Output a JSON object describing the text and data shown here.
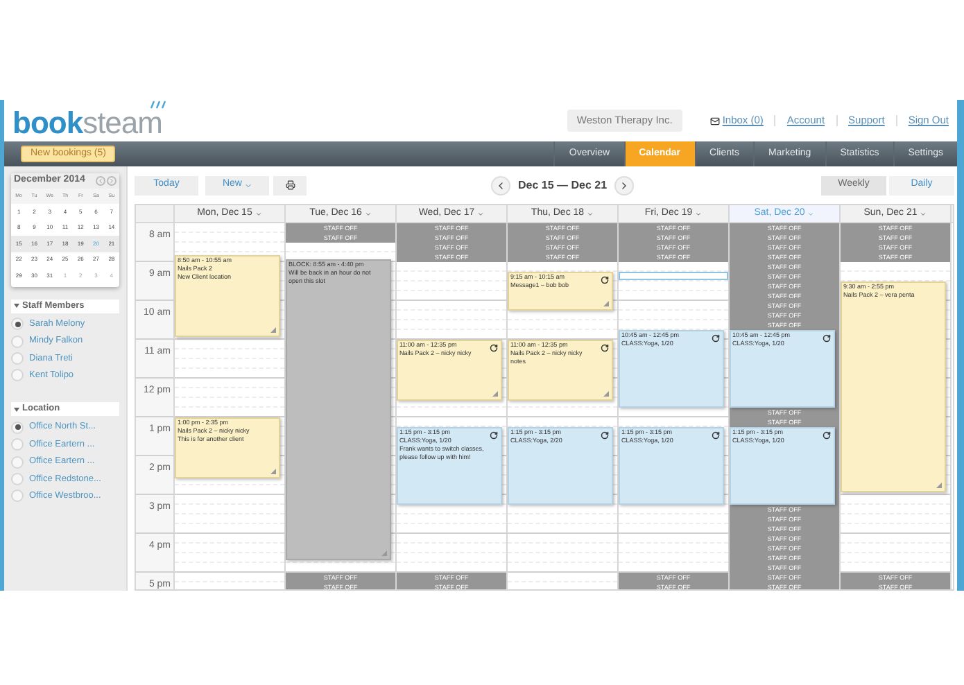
{
  "logo": {
    "bold": "book",
    "light": "steam"
  },
  "header": {
    "company": "Weston Therapy Inc.",
    "links": [
      {
        "label": "Inbox (0)",
        "kind": "inbox"
      },
      {
        "label": "Account",
        "kind": "link"
      },
      {
        "label": "Support",
        "kind": "link"
      },
      {
        "label": "Sign Out",
        "kind": "link"
      }
    ]
  },
  "new_bookings": "New bookings (5)",
  "nav": [
    {
      "label": "Overview",
      "selected": false
    },
    {
      "label": "Calendar",
      "selected": true
    },
    {
      "label": "Clients",
      "selected": false
    },
    {
      "label": "Marketing",
      "selected": false
    },
    {
      "label": "Statistics",
      "selected": false
    },
    {
      "label": "Settings",
      "selected": false
    }
  ],
  "mini_calendar": {
    "title": "December 2014",
    "weekdays": [
      "Mo",
      "Tu",
      "We",
      "Th",
      "Fr",
      "Sa",
      "Su"
    ],
    "weeks": [
      {
        "selected": false,
        "days": [
          {
            "label": "1",
            "muted": false,
            "today": false
          },
          {
            "label": "2",
            "muted": false,
            "today": false
          },
          {
            "label": "3",
            "muted": false,
            "today": false
          },
          {
            "label": "4",
            "muted": false,
            "today": false
          },
          {
            "label": "5",
            "muted": false,
            "today": false
          },
          {
            "label": "6",
            "muted": false,
            "today": false
          },
          {
            "label": "7",
            "muted": false,
            "today": false
          }
        ]
      },
      {
        "selected": false,
        "days": [
          {
            "label": "8",
            "muted": false,
            "today": false
          },
          {
            "label": "9",
            "muted": false,
            "today": false
          },
          {
            "label": "10",
            "muted": false,
            "today": false
          },
          {
            "label": "11",
            "muted": false,
            "today": false
          },
          {
            "label": "12",
            "muted": false,
            "today": false
          },
          {
            "label": "13",
            "muted": false,
            "today": false
          },
          {
            "label": "14",
            "muted": false,
            "today": false
          }
        ]
      },
      {
        "selected": true,
        "days": [
          {
            "label": "15",
            "muted": false,
            "today": false
          },
          {
            "label": "16",
            "muted": false,
            "today": false
          },
          {
            "label": "17",
            "muted": false,
            "today": false
          },
          {
            "label": "18",
            "muted": false,
            "today": false
          },
          {
            "label": "19",
            "muted": false,
            "today": false
          },
          {
            "label": "20",
            "muted": false,
            "today": true
          },
          {
            "label": "21",
            "muted": false,
            "today": false
          }
        ]
      },
      {
        "selected": false,
        "days": [
          {
            "label": "22",
            "muted": false,
            "today": false
          },
          {
            "label": "23",
            "muted": false,
            "today": false
          },
          {
            "label": "24",
            "muted": false,
            "today": false
          },
          {
            "label": "25",
            "muted": false,
            "today": false
          },
          {
            "label": "26",
            "muted": false,
            "today": false
          },
          {
            "label": "27",
            "muted": false,
            "today": false
          },
          {
            "label": "28",
            "muted": false,
            "today": false
          }
        ]
      },
      {
        "selected": false,
        "days": [
          {
            "label": "29",
            "muted": false,
            "today": false
          },
          {
            "label": "30",
            "muted": false,
            "today": false
          },
          {
            "label": "31",
            "muted": false,
            "today": false
          },
          {
            "label": "1",
            "muted": true,
            "today": false
          },
          {
            "label": "2",
            "muted": true,
            "today": false
          },
          {
            "label": "3",
            "muted": true,
            "today": false
          },
          {
            "label": "4",
            "muted": true,
            "today": false
          }
        ]
      }
    ]
  },
  "sections": [
    {
      "title": "Staff Members",
      "items": [
        {
          "label": "Sarah Melony",
          "selected": true
        },
        {
          "label": "Mindy Falkon",
          "selected": false
        },
        {
          "label": "Diana Treti",
          "selected": false
        },
        {
          "label": "Kent Tolipo",
          "selected": false
        }
      ]
    },
    {
      "title": "Location",
      "items": [
        {
          "label": "Office North St...",
          "selected": true
        },
        {
          "label": "Office Eartern ...",
          "selected": false
        },
        {
          "label": "Office Eartern ...",
          "selected": false
        },
        {
          "label": "Office Redstone...",
          "selected": false
        },
        {
          "label": "Office Westbroo...",
          "selected": false
        }
      ]
    }
  ],
  "toolbar": {
    "today": "Today",
    "new": "New",
    "range": "Dec 15 — Dec 21",
    "views": [
      {
        "label": "Weekly",
        "selected": true
      },
      {
        "label": "Daily",
        "selected": false
      }
    ]
  },
  "hours": [
    "8 am",
    "9 am",
    "10 am",
    "11 am",
    "12 pm",
    "1 pm",
    "2 pm",
    "3 pm",
    "4 pm",
    "5 pm"
  ],
  "days": [
    {
      "label": "Mon, Dec 15",
      "today": false,
      "events": [
        {
          "kind": "appointment",
          "recurring": false,
          "lines": [
            "8:50 am - 10:55 am",
            "Nails Pack 2",
            "New Client location"
          ]
        },
        {
          "kind": "appointment",
          "recurring": false,
          "lines": [
            "1:00 pm - 2:35 pm",
            "Nails Pack 2 – nicky nicky",
            "This is for another client"
          ]
        }
      ]
    },
    {
      "label": "Tue, Dec 16",
      "today": false,
      "quarters": [
        {
          "kind": "off",
          "label": "STAFF OFF"
        },
        {
          "kind": "off",
          "label": "STAFF OFF"
        },
        {
          "kind": "free"
        },
        {
          "kind": "free"
        },
        {
          "kind": "free"
        },
        {
          "kind": "free"
        },
        {
          "kind": "free"
        },
        {
          "kind": "free"
        },
        {
          "kind": "free"
        },
        {
          "kind": "free"
        },
        {
          "kind": "free"
        },
        {
          "kind": "free"
        },
        {
          "kind": "free"
        },
        {
          "kind": "free"
        },
        {
          "kind": "free"
        },
        {
          "kind": "free"
        },
        {
          "kind": "free"
        },
        {
          "kind": "free"
        },
        {
          "kind": "free"
        },
        {
          "kind": "free"
        },
        {
          "kind": "free"
        },
        {
          "kind": "free"
        },
        {
          "kind": "free"
        },
        {
          "kind": "free"
        },
        {
          "kind": "free"
        },
        {
          "kind": "free"
        },
        {
          "kind": "free"
        },
        {
          "kind": "free"
        },
        {
          "kind": "free"
        },
        {
          "kind": "free"
        },
        {
          "kind": "free"
        },
        {
          "kind": "free"
        },
        {
          "kind": "free"
        },
        {
          "kind": "free"
        },
        {
          "kind": "free"
        },
        {
          "kind": "free"
        },
        {
          "kind": "off",
          "label": "STAFF OFF"
        },
        {
          "kind": "off",
          "label": "STAFF OFF"
        }
      ],
      "events": [
        {
          "kind": "block",
          "recurring": false,
          "lines": [
            "BLOCK: 8:55 am - 4:40 pm",
            "Will be back in an hour do not open this slot"
          ]
        }
      ]
    },
    {
      "label": "Wed, Dec 17",
      "today": false,
      "quarters": [
        {
          "kind": "off",
          "label": "STAFF OFF"
        },
        {
          "kind": "off",
          "label": "STAFF OFF"
        },
        {
          "kind": "off",
          "label": "STAFF OFF"
        },
        {
          "kind": "off",
          "label": "STAFF OFF"
        },
        {
          "kind": "free"
        },
        {
          "kind": "free"
        },
        {
          "kind": "free"
        },
        {
          "kind": "free"
        },
        {
          "kind": "free"
        },
        {
          "kind": "free"
        },
        {
          "kind": "free"
        },
        {
          "kind": "free"
        },
        {
          "kind": "free"
        },
        {
          "kind": "free"
        },
        {
          "kind": "free"
        },
        {
          "kind": "free"
        },
        {
          "kind": "free"
        },
        {
          "kind": "free"
        },
        {
          "kind": "free"
        },
        {
          "kind": "free"
        },
        {
          "kind": "free"
        },
        {
          "kind": "free"
        },
        {
          "kind": "free"
        },
        {
          "kind": "free"
        },
        {
          "kind": "free"
        },
        {
          "kind": "free"
        },
        {
          "kind": "free"
        },
        {
          "kind": "free"
        },
        {
          "kind": "free"
        },
        {
          "kind": "free"
        },
        {
          "kind": "free"
        },
        {
          "kind": "free"
        },
        {
          "kind": "free"
        },
        {
          "kind": "free"
        },
        {
          "kind": "free"
        },
        {
          "kind": "free"
        },
        {
          "kind": "off",
          "label": "STAFF OFF"
        },
        {
          "kind": "off",
          "label": "STAFF OFF"
        }
      ],
      "events": [
        {
          "kind": "appointment",
          "recurring": true,
          "lines": [
            "11:00 am - 12:35 pm",
            "Nails Pack 2 – nicky nicky"
          ]
        },
        {
          "kind": "class",
          "recurring": true,
          "lines": [
            "1:15 pm - 3:15 pm",
            "CLASS:Yoga, 1/20",
            "Frank wants to switch classes, please follow up with him!"
          ]
        }
      ]
    },
    {
      "label": "Thu, Dec 18",
      "today": false,
      "quarters": [
        {
          "kind": "off",
          "label": "STAFF OFF"
        },
        {
          "kind": "off",
          "label": "STAFF OFF"
        },
        {
          "kind": "off",
          "label": "STAFF OFF"
        },
        {
          "kind": "off",
          "label": "STAFF OFF"
        }
      ],
      "events": [
        {
          "kind": "appointment",
          "recurring": true,
          "lines": [
            "9:15 am - 10:15 am",
            "Message1 – bob bob"
          ]
        },
        {
          "kind": "appointment",
          "recurring": true,
          "lines": [
            "11:00 am - 12:35 pm",
            "Nails Pack 2 – nicky nicky",
            "notes"
          ]
        },
        {
          "kind": "class",
          "recurring": true,
          "lines": [
            "1:15 pm - 3:15 pm",
            "CLASS:Yoga, 2/20"
          ]
        }
      ]
    },
    {
      "label": "Fri, Dec 19",
      "today": false,
      "quarters": [
        {
          "kind": "off",
          "label": "STAFF OFF"
        },
        {
          "kind": "off",
          "label": "STAFF OFF"
        },
        {
          "kind": "off",
          "label": "STAFF OFF"
        },
        {
          "kind": "off",
          "label": "STAFF OFF"
        },
        {
          "kind": "free"
        },
        {
          "kind": "selected"
        },
        {
          "kind": "free"
        },
        {
          "kind": "free"
        },
        {
          "kind": "free"
        },
        {
          "kind": "free"
        },
        {
          "kind": "free"
        },
        {
          "kind": "free"
        },
        {
          "kind": "free"
        },
        {
          "kind": "free"
        },
        {
          "kind": "free"
        },
        {
          "kind": "free"
        },
        {
          "kind": "free"
        },
        {
          "kind": "free"
        },
        {
          "kind": "free"
        },
        {
          "kind": "free"
        },
        {
          "kind": "free"
        },
        {
          "kind": "free"
        },
        {
          "kind": "free"
        },
        {
          "kind": "free"
        },
        {
          "kind": "free"
        },
        {
          "kind": "free"
        },
        {
          "kind": "free"
        },
        {
          "kind": "free"
        },
        {
          "kind": "free"
        },
        {
          "kind": "free"
        },
        {
          "kind": "free"
        },
        {
          "kind": "free"
        },
        {
          "kind": "free"
        },
        {
          "kind": "free"
        },
        {
          "kind": "free"
        },
        {
          "kind": "free"
        },
        {
          "kind": "off",
          "label": "STAFF OFF"
        },
        {
          "kind": "off",
          "label": "STAFF OFF"
        }
      ],
      "events": [
        {
          "kind": "class",
          "recurring": true,
          "lines": [
            "10:45 am - 12:45 pm",
            "CLASS:Yoga, 1/20"
          ]
        },
        {
          "kind": "class",
          "recurring": true,
          "lines": [
            "1:15 pm - 3:15 pm",
            "CLASS:Yoga, 1/20"
          ]
        }
      ]
    },
    {
      "label": "Sat, Dec 20",
      "today": true,
      "quarters": [
        {
          "kind": "off",
          "label": "STAFF OFF"
        },
        {
          "kind": "off",
          "label": "STAFF OFF"
        },
        {
          "kind": "off",
          "label": "STAFF OFF"
        },
        {
          "kind": "off",
          "label": "STAFF OFF"
        },
        {
          "kind": "off",
          "label": "STAFF OFF"
        },
        {
          "kind": "off",
          "label": "STAFF OFF"
        },
        {
          "kind": "off",
          "label": "STAFF OFF"
        },
        {
          "kind": "off",
          "label": "STAFF OFF"
        },
        {
          "kind": "off",
          "label": "STAFF OFF"
        },
        {
          "kind": "off",
          "label": "STAFF OFF"
        },
        {
          "kind": "off",
          "label": "STAFF OFF"
        },
        {
          "kind": "off"
        },
        {
          "kind": "off"
        },
        {
          "kind": "off"
        },
        {
          "kind": "off"
        },
        {
          "kind": "off"
        },
        {
          "kind": "off"
        },
        {
          "kind": "off"
        },
        {
          "kind": "off"
        },
        {
          "kind": "off",
          "label": "STAFF OFF"
        },
        {
          "kind": "off",
          "label": "STAFF OFF"
        },
        {
          "kind": "off"
        },
        {
          "kind": "off"
        },
        {
          "kind": "off"
        },
        {
          "kind": "off"
        },
        {
          "kind": "off"
        },
        {
          "kind": "off"
        },
        {
          "kind": "off"
        },
        {
          "kind": "off"
        },
        {
          "kind": "off",
          "label": "STAFF OFF"
        },
        {
          "kind": "off",
          "label": "STAFF OFF"
        },
        {
          "kind": "off",
          "label": "STAFF OFF"
        },
        {
          "kind": "off",
          "label": "STAFF OFF"
        },
        {
          "kind": "off",
          "label": "STAFF OFF"
        },
        {
          "kind": "off",
          "label": "STAFF OFF"
        },
        {
          "kind": "off",
          "label": "STAFF OFF"
        },
        {
          "kind": "off",
          "label": "STAFF OFF"
        },
        {
          "kind": "off",
          "label": "STAFF OFF"
        }
      ],
      "events": [
        {
          "kind": "class",
          "recurring": true,
          "lines": [
            "10:45 am - 12:45 pm",
            "CLASS:Yoga, 1/20"
          ]
        },
        {
          "kind": "class",
          "recurring": true,
          "lines": [
            "1:15 pm - 3:15 pm",
            "CLASS:Yoga, 1/20"
          ]
        }
      ]
    },
    {
      "label": "Sun, Dec 21",
      "today": false,
      "quarters": [
        {
          "kind": "off",
          "label": "STAFF OFF"
        },
        {
          "kind": "off",
          "label": "STAFF OFF"
        },
        {
          "kind": "off",
          "label": "STAFF OFF"
        },
        {
          "kind": "off",
          "label": "STAFF OFF"
        },
        {
          "kind": "free"
        },
        {
          "kind": "free"
        },
        {
          "kind": "free"
        },
        {
          "kind": "free"
        },
        {
          "kind": "free"
        },
        {
          "kind": "free"
        },
        {
          "kind": "free"
        },
        {
          "kind": "free"
        },
        {
          "kind": "free"
        },
        {
          "kind": "free"
        },
        {
          "kind": "free"
        },
        {
          "kind": "free"
        },
        {
          "kind": "free"
        },
        {
          "kind": "free"
        },
        {
          "kind": "free"
        },
        {
          "kind": "free"
        },
        {
          "kind": "free"
        },
        {
          "kind": "free"
        },
        {
          "kind": "free"
        },
        {
          "kind": "free"
        },
        {
          "kind": "free"
        },
        {
          "kind": "free"
        },
        {
          "kind": "free"
        },
        {
          "kind": "free"
        },
        {
          "kind": "free"
        },
        {
          "kind": "free"
        },
        {
          "kind": "free"
        },
        {
          "kind": "free"
        },
        {
          "kind": "free"
        },
        {
          "kind": "free"
        },
        {
          "kind": "free"
        },
        {
          "kind": "free"
        },
        {
          "kind": "off",
          "label": "STAFF OFF"
        },
        {
          "kind": "off",
          "label": "STAFF OFF"
        }
      ],
      "events": [
        {
          "kind": "appointment",
          "recurring": false,
          "lines": [
            "9:30 am - 2:55 pm",
            "Nails Pack 2 – vera penta"
          ]
        }
      ]
    }
  ]
}
